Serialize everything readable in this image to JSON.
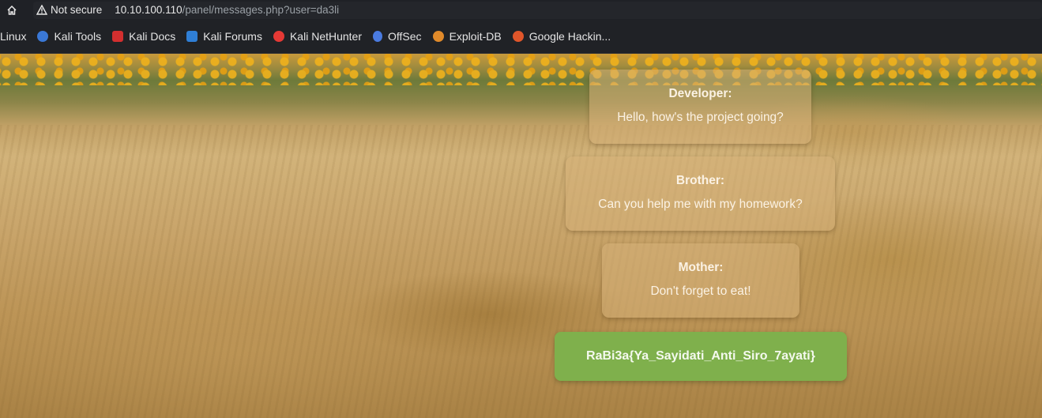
{
  "browser": {
    "security_label": "Not secure",
    "url_host": "10.10.100.110",
    "url_path": "/panel/messages.php?user=da3li"
  },
  "bookmarks": [
    {
      "label": "Linux",
      "icon": "none"
    },
    {
      "label": "Kali Tools",
      "icon": "kali-tools-icon",
      "color": "#3a78d6"
    },
    {
      "label": "Kali Docs",
      "icon": "kali-docs-icon",
      "color": "#d32f2f"
    },
    {
      "label": "Kali Forums",
      "icon": "kali-forums-icon",
      "color": "#2f7fd6"
    },
    {
      "label": "Kali NetHunter",
      "icon": "kali-nethunter-icon",
      "color": "#e53935"
    },
    {
      "label": "OffSec",
      "icon": "offsec-icon",
      "color": "#4a7be0"
    },
    {
      "label": "Exploit-DB",
      "icon": "exploit-db-icon",
      "color": "#e08a2a"
    },
    {
      "label": "Google Hackin...",
      "icon": "google-hacking-icon",
      "color": "#e0562a"
    }
  ],
  "messages": [
    {
      "sender": "Developer:",
      "text": "Hello, how's the project going?"
    },
    {
      "sender": "Brother:",
      "text": "Can you help me with my homework?"
    },
    {
      "sender": "Mother:",
      "text": "Don't forget to eat!"
    }
  ],
  "flag": "RaBi3a{Ya_Sayidati_Anti_Siro_7ayati}"
}
